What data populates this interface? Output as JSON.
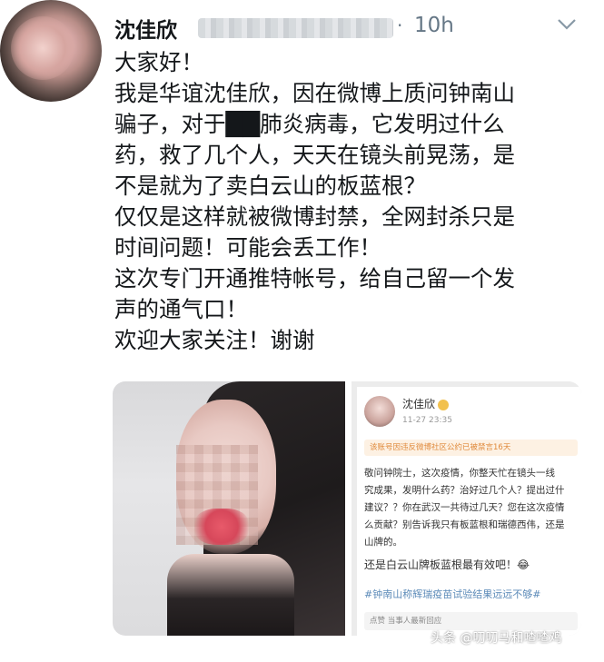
{
  "header": {
    "name": "沈佳欣",
    "time": "10h"
  },
  "tweet": {
    "lines": [
      "大家好！",
      "我是华谊沈佳欣，因在微博上质问钟南山",
      "骗子，对于██肺炎病毒，它发明过什么",
      "药，救了几个人，天天在镜头前晃荡，是",
      "不是就为了卖白云山的板蓝根？",
      "仅仅是这样就被微博封禁，全网封杀只是",
      "时间问题！可能会丢工作！",
      "这次专门开通推特帐号，给自己留一个发",
      "声的通气口！",
      "欢迎大家关注！谢谢"
    ]
  },
  "embedded_screenshot": {
    "name": "沈佳欣",
    "time": "11-27 23:35",
    "warning": "该账号因违反微博社区公约已被禁言16天",
    "body_lines": [
      "敬问钟院士，这次疫情，你整天忙在镜头一线",
      "究成果，发明什么药？治好过几个人？提出过什",
      "建议？？你在武汉一共待过几天？您在这次疫情",
      "么贡献？别告诉我只有板蓝根和瑞德西伟，还是",
      "山牌的。"
    ],
    "highlight": "还是白云山牌板蓝根最有效吧！😂",
    "hashtag": "#钟南山称辉瑞疫苗试验结果远远不够#",
    "footer": "点赞  当事人最新回应"
  },
  "watermark": "头条 @叨叨马和喳喳鸡",
  "icons": {
    "menu": "chevron-down-icon"
  }
}
